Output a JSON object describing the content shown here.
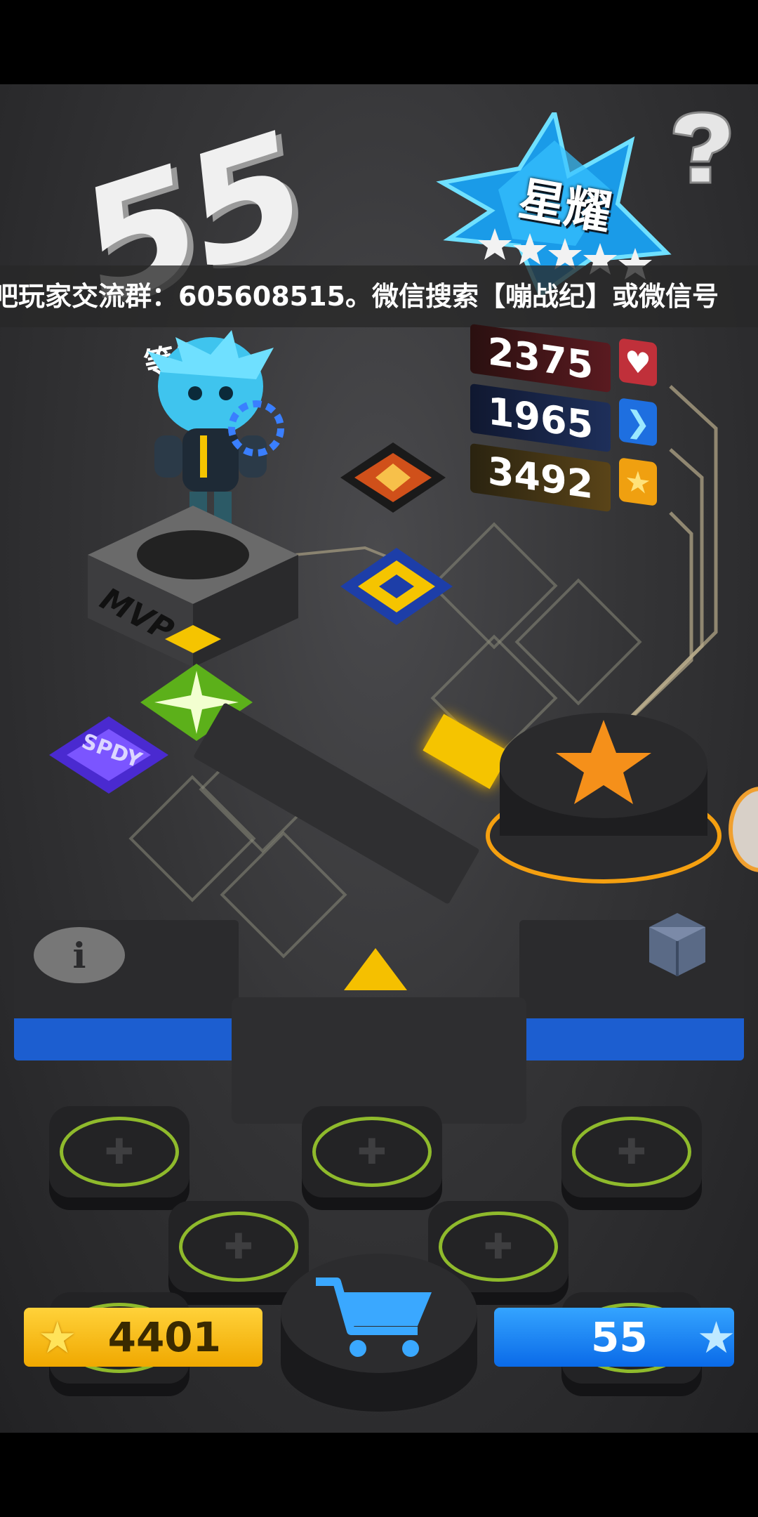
{
  "level": {
    "number": "55",
    "label": "等级"
  },
  "marquee": {
    "text": "吧玩家交流群：605608515。微信搜索【嘣战纪】或微信号"
  },
  "rank": {
    "title": "星耀",
    "stars_filled": 5,
    "stars_total": 5
  },
  "stats": [
    {
      "value": "2375",
      "icon": "heart-icon",
      "color": "#c0303a"
    },
    {
      "value": "1965",
      "icon": "chevron-right-icon",
      "color": "#1e6fe0"
    },
    {
      "value": "3492",
      "icon": "star-icon",
      "color": "#f0a010"
    }
  ],
  "badge": {
    "mvp": "MVP"
  },
  "items": [
    {
      "name": "burst-card",
      "label": ""
    },
    {
      "name": "fire-card",
      "label": ""
    },
    {
      "name": "sparkle-card",
      "label": ""
    },
    {
      "name": "speed-card",
      "label": "SPDY"
    }
  ],
  "currencies": {
    "gold": {
      "value": "4401",
      "icon": "star-icon",
      "color": "#f5b800"
    },
    "blue": {
      "value": "55",
      "icon": "star-icon",
      "color": "#1d7ff0"
    }
  },
  "icons": {
    "help": "question-icon",
    "info": "info-icon",
    "dice": "dice-icon",
    "cart": "cart-icon",
    "arrow": "triangle-up-icon",
    "star_button": "star-icon"
  },
  "colors": {
    "accent_gold": "#f5b800",
    "accent_blue": "#1d7ff0",
    "ring_green": "#8fba2c"
  }
}
